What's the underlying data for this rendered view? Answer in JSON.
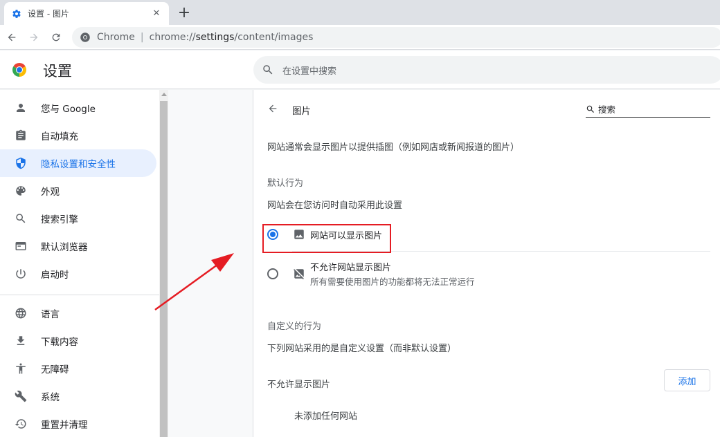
{
  "tab": {
    "title": "设置 - 图片",
    "close": "✕",
    "new_tab": "+"
  },
  "omnibox": {
    "label": "Chrome",
    "separator": "|",
    "url_prefix": "chrome://",
    "url_host": "settings",
    "url_path": "/content/images"
  },
  "header": {
    "title": "设置",
    "search_placeholder": "在设置中搜索"
  },
  "sidebar": {
    "items": [
      {
        "label": "您与 Google",
        "icon": "person-icon"
      },
      {
        "label": "自动填充",
        "icon": "clipboard-icon"
      },
      {
        "label": "隐私设置和安全性",
        "icon": "shield-icon",
        "active": true
      },
      {
        "label": "外观",
        "icon": "palette-icon"
      },
      {
        "label": "搜索引擎",
        "icon": "search-icon"
      },
      {
        "label": "默认浏览器",
        "icon": "browser-icon"
      },
      {
        "label": "启动时",
        "icon": "power-icon"
      },
      {
        "label": "语言",
        "icon": "globe-icon"
      },
      {
        "label": "下载内容",
        "icon": "download-icon"
      },
      {
        "label": "无障碍",
        "icon": "accessibility-icon"
      },
      {
        "label": "系统",
        "icon": "wrench-icon"
      },
      {
        "label": "重置并清理",
        "icon": "history-icon"
      }
    ]
  },
  "content": {
    "title": "图片",
    "search_label": "搜索",
    "description": "网站通常会显示图片以提供插图（例如网店或新闻报道的图片）",
    "default_heading": "默认行为",
    "default_sub": "网站会在您访问时自动采用此设置",
    "option_allow": "网站可以显示图片",
    "option_block": "不允许网站显示图片",
    "option_block_sub": "所有需要使用图片的功能都将无法正常运行",
    "custom_heading": "自定义的行为",
    "custom_sub": "下列网站采用的是自定义设置（而非默认设置）",
    "blocked_heading": "不允许显示图片",
    "add_button": "添加",
    "empty_text": "未添加任何网站"
  },
  "colors": {
    "accent": "#1a73e8",
    "annotation": "#e51c23"
  }
}
